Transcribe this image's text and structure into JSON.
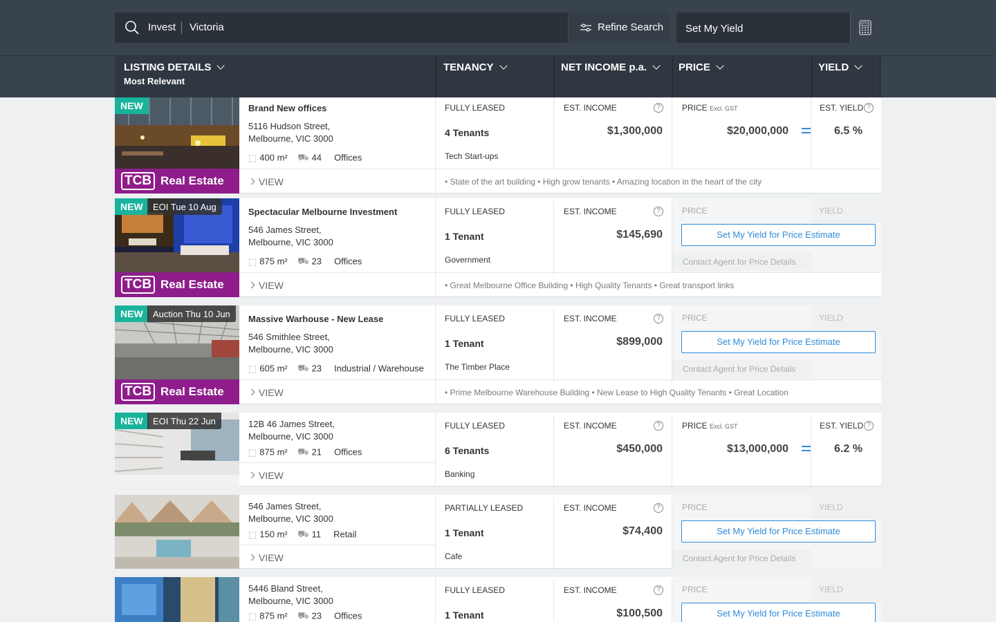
{
  "search": {
    "segment1": "Invest",
    "segment2": "Victoria",
    "refine_label": "Refine Search",
    "yield_label": "Set My Yield"
  },
  "columns": {
    "listing": "LISTING DETAILS",
    "listing_sub": "Most Relevant",
    "tenancy": "TENANCY",
    "net_income": "NET INCOME p.a.",
    "price": "PRICE",
    "yield": "YIELD"
  },
  "common": {
    "view": "VIEW",
    "brand_tcb": "TCB",
    "brand_name": "Real Estate",
    "new": "NEW",
    "est_income": "EST. INCOME",
    "price_label": "PRICE",
    "excl_gst": "Excl. GST",
    "est_yield": "EST. YIELD",
    "price_muted": "PRICE",
    "yield_muted": "YIELD",
    "set_yield_btn": "Set My Yield for Price Estimate",
    "contact": "Contact Agent for Price Details",
    "q": "?",
    "accent": "#2f8bd9",
    "brand_color": "#8e1d8b",
    "new_color": "#19b39c"
  },
  "listings": [
    {
      "title": "Brand New offices",
      "addr1": "5116 Hudson Street,",
      "addr2": "Melbourne, VIC 3000",
      "area": "400 m²",
      "parking": "44",
      "type": "Offices",
      "status": "FULLY LEASED",
      "tenants": "4 Tenants",
      "industry": "Tech Start-ups",
      "income": "$1,300,000",
      "price": "$20,000,000",
      "yield": "6.5 %",
      "tags": "• State of the art building • High grow tenants • Amazing location in the heart of the city"
    },
    {
      "event": "EOI Tue 10 Aug",
      "title": "Spectacular Melbourne Investment",
      "addr1": "546 James Street,",
      "addr2": "Melbourne, VIC 3000",
      "area": "875 m²",
      "parking": "23",
      "type": "Offices",
      "status": "FULLY LEASED",
      "tenants": "1 Tenant",
      "industry": "Government",
      "income": "$145,690",
      "tags": "• Great Melbourne Office Building • High Quality Tenants • Great transport links"
    },
    {
      "event": "Auction Thu 10 Jun",
      "title": "Massive Warhouse - New Lease",
      "addr1": "546 Smithlee Street,",
      "addr2": "Melbourne, VIC 3000",
      "area": "605 m²",
      "parking": "23",
      "type": "Industrial / Warehouse",
      "status": "FULLY LEASED",
      "tenants": "1 Tenant",
      "industry": "The Timber Place",
      "income": "$899,000",
      "tags": "• Prime Melbourne Warehouse Building • New Lease to High Quality Tenants • Great Location"
    },
    {
      "event": "EOI Thu 22 Jun",
      "addr1": "12B 46 James Street,",
      "addr2": "Melbourne, VIC 3000",
      "area": "875 m²",
      "parking": "21",
      "type": "Offices",
      "status": "FULLY LEASED",
      "tenants": "6 Tenants",
      "industry": "Banking",
      "income": "$450,000",
      "price": "$13,000,000",
      "yield": "6.2 %"
    },
    {
      "addr1": "546 James Street,",
      "addr2": "Melbourne, VIC 3000",
      "area": "150 m²",
      "parking": "11",
      "type": "Retail",
      "status": "PARTIALLY LEASED",
      "tenants": "1 Tenant",
      "industry": "Cafe",
      "income": "$74,400"
    },
    {
      "addr1": "5446 Bland Street,",
      "addr2": "Melbourne, VIC 3000",
      "area": "875 m²",
      "parking": "23",
      "type": "Offices",
      "status": "FULLY LEASED",
      "tenants": "1 Tenant",
      "income": "$100,500"
    }
  ]
}
